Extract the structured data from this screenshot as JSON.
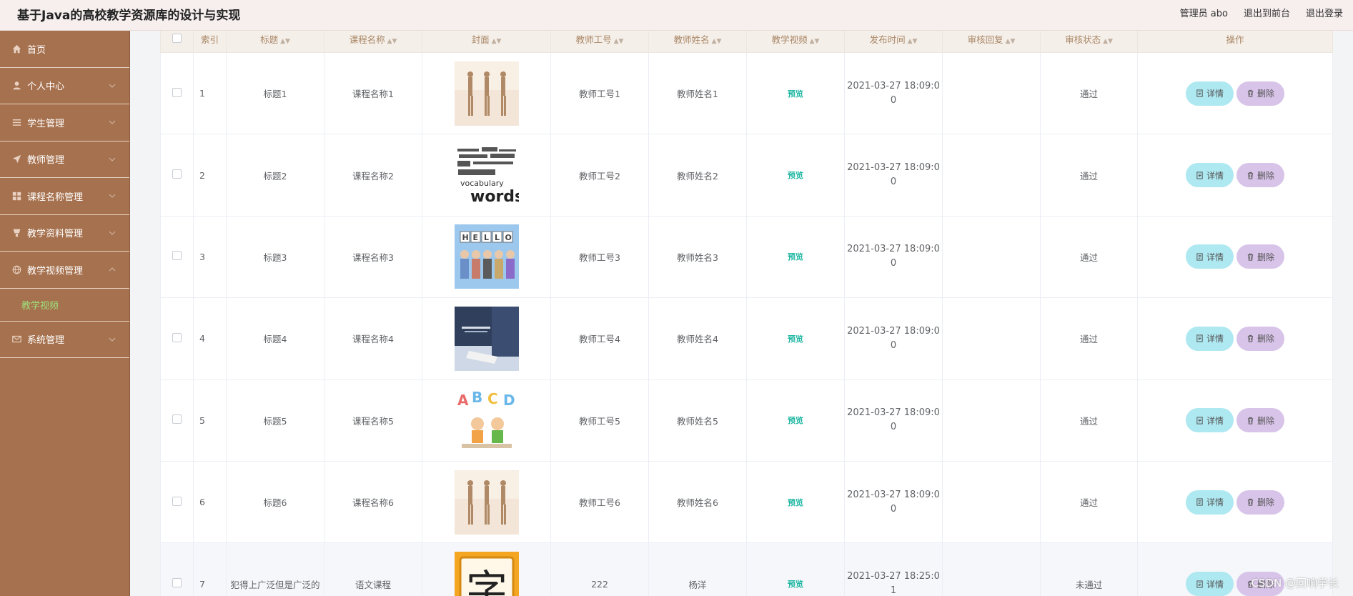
{
  "header": {
    "title": "基于Java的高校教学资源库的设计与实现",
    "admin_label": "管理员 abo",
    "back_front_label": "退出到前台",
    "logout_label": "退出登录"
  },
  "sidebar": {
    "items": [
      {
        "label": "首页",
        "icon": "home-icon"
      },
      {
        "label": "个人中心",
        "icon": "user-icon"
      },
      {
        "label": "学生管理",
        "icon": "list-icon"
      },
      {
        "label": "教师管理",
        "icon": "send-icon"
      },
      {
        "label": "课程名称管理",
        "icon": "grid-icon"
      },
      {
        "label": "教学资料管理",
        "icon": "goods-icon"
      },
      {
        "label": "教学视频管理",
        "icon": "globe-icon"
      },
      {
        "label": "系统管理",
        "icon": "mail-icon"
      }
    ],
    "active_sub": "教学视频"
  },
  "table": {
    "headers": [
      "索引",
      "标题",
      "课程名称",
      "封面",
      "教师工号",
      "教师姓名",
      "教学视频",
      "发布时间",
      "审核回复",
      "审核状态",
      "操作"
    ],
    "preview_label": "预览",
    "detail_label": "详情",
    "delete_label": "删除",
    "rows": [
      {
        "index": "1",
        "title": "标题1",
        "course": "课程名称1",
        "cover": "dance",
        "teacher_no": "教师工号1",
        "teacher_name": "教师姓名1",
        "date_a": "2021-03-27 18:09:0",
        "date_b": "0",
        "reply": "",
        "status": "通过"
      },
      {
        "index": "2",
        "title": "标题2",
        "course": "课程名称2",
        "cover": "words",
        "teacher_no": "教师工号2",
        "teacher_name": "教师姓名2",
        "date_a": "2021-03-27 18:09:0",
        "date_b": "0",
        "reply": "",
        "status": "通过"
      },
      {
        "index": "3",
        "title": "标题3",
        "course": "课程名称3",
        "cover": "hello",
        "teacher_no": "教师工号3",
        "teacher_name": "教师姓名3",
        "date_a": "2021-03-27 18:09:0",
        "date_b": "0",
        "reply": "",
        "status": "通过"
      },
      {
        "index": "4",
        "title": "标题4",
        "course": "课程名称4",
        "cover": "study",
        "teacher_no": "教师工号4",
        "teacher_name": "教师姓名4",
        "date_a": "2021-03-27 18:09:0",
        "date_b": "0",
        "reply": "",
        "status": "通过"
      },
      {
        "index": "5",
        "title": "标题5",
        "course": "课程名称5",
        "cover": "abcd",
        "teacher_no": "教师工号5",
        "teacher_name": "教师姓名5",
        "date_a": "2021-03-27 18:09:0",
        "date_b": "0",
        "reply": "",
        "status": "通过"
      },
      {
        "index": "6",
        "title": "标题6",
        "course": "课程名称6",
        "cover": "dance",
        "teacher_no": "教师工号6",
        "teacher_name": "教师姓名6",
        "date_a": "2021-03-27 18:09:0",
        "date_b": "0",
        "reply": "",
        "status": "通过"
      },
      {
        "index": "7",
        "title": "犯得上广泛但是广泛的",
        "course": "语文课程",
        "cover": "zi",
        "teacher_no": "222",
        "teacher_name": "杨洋",
        "date_a": "2021-03-27 18:25:0",
        "date_b": "1",
        "reply": "",
        "status": "未通过"
      }
    ]
  },
  "watermark": "CSDN @回响学长",
  "colors": {
    "sidebar_bg": "#a6714e",
    "header_bg": "#f6efee",
    "detail_btn": "#aee8f1",
    "delete_btn": "#d8c3e9",
    "preview_link": "#1fb7a2",
    "active_submenu": "#9ee07b"
  }
}
